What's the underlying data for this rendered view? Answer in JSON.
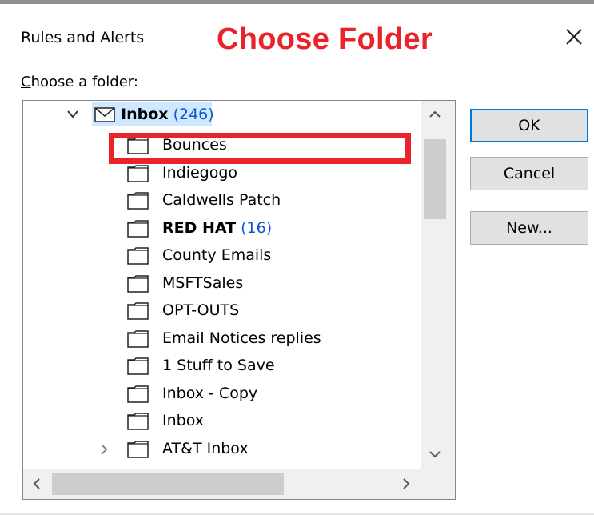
{
  "dialog": {
    "title": "Rules and Alerts",
    "annotation": "Choose Folder",
    "annotation_color": "#e8232a",
    "close_icon": "close-icon"
  },
  "folder_label": {
    "accel": "C",
    "rest": "hoose a folder:"
  },
  "tree": {
    "root": {
      "name": "Inbox",
      "count": "(246)",
      "expanded": true,
      "icon": "mail-icon",
      "selected_highlight": "#cde8ff"
    },
    "items": [
      {
        "name": "Bounces",
        "count": "",
        "bold": false,
        "expandable": false
      },
      {
        "name": "Indiegogo",
        "count": "",
        "bold": false,
        "expandable": false
      },
      {
        "name": "Caldwells Patch",
        "count": "",
        "bold": false,
        "expandable": false
      },
      {
        "name": "RED HAT",
        "count": "(16)",
        "bold": true,
        "expandable": false
      },
      {
        "name": "County Emails",
        "count": "",
        "bold": false,
        "expandable": false
      },
      {
        "name": "MSFTSales",
        "count": "",
        "bold": false,
        "expandable": false
      },
      {
        "name": "OPT-OUTS",
        "count": "",
        "bold": false,
        "expandable": false
      },
      {
        "name": "Email Notices replies",
        "count": "",
        "bold": false,
        "expandable": false
      },
      {
        "name": "1 Stuff to Save",
        "count": "",
        "bold": false,
        "expandable": false
      },
      {
        "name": "Inbox - Copy",
        "count": "",
        "bold": false,
        "expandable": false
      },
      {
        "name": "Inbox",
        "count": "",
        "bold": false,
        "expandable": false
      },
      {
        "name": "AT&T Inbox",
        "count": "",
        "bold": false,
        "expandable": true
      }
    ],
    "count_color": "#1155cc"
  },
  "buttons": {
    "ok": "OK",
    "cancel": "Cancel",
    "new_accel": "N",
    "new_rest": "ew..."
  },
  "highlight_box_target": "Bounces"
}
